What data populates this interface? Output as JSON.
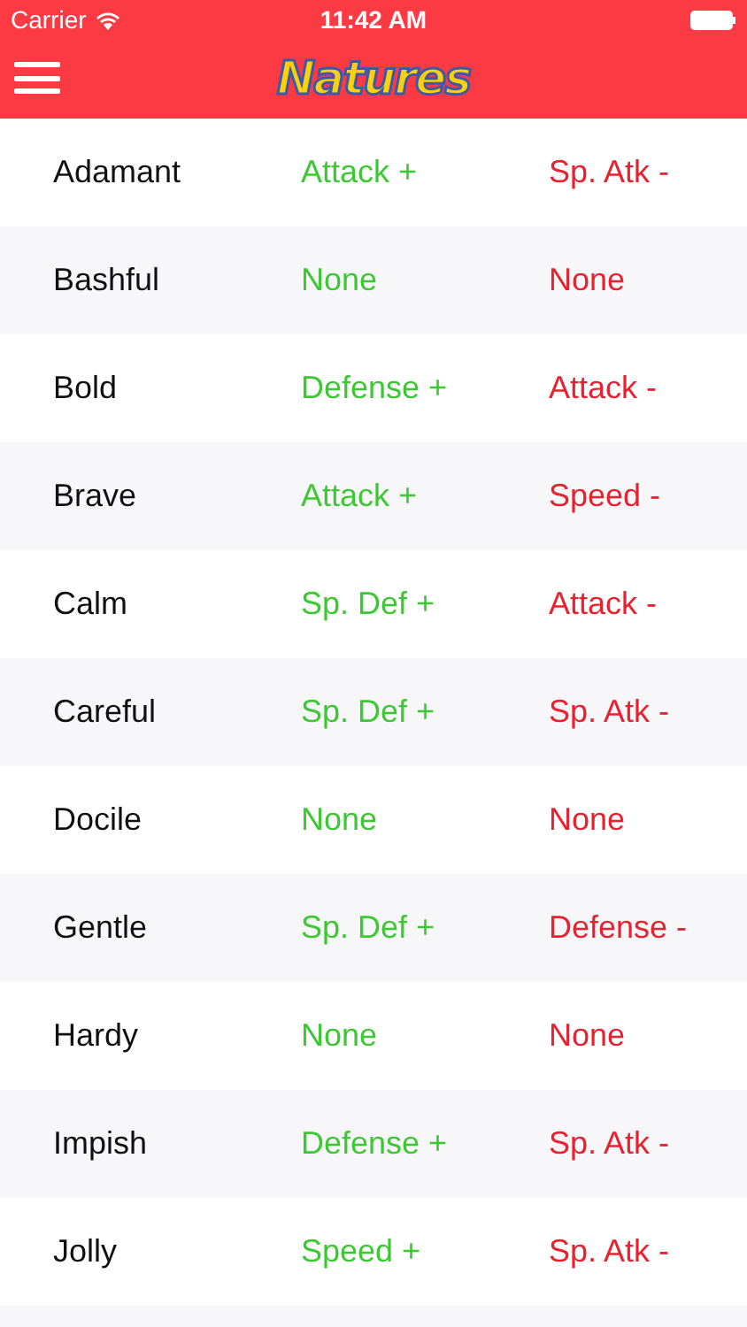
{
  "status_bar": {
    "carrier": "Carrier",
    "time": "11:42 AM"
  },
  "nav_bar": {
    "title": "Natures"
  },
  "natures": [
    {
      "name": "Adamant",
      "increased": "Attack +",
      "decreased": "Sp. Atk -"
    },
    {
      "name": "Bashful",
      "increased": "None",
      "decreased": "None"
    },
    {
      "name": "Bold",
      "increased": "Defense +",
      "decreased": "Attack -"
    },
    {
      "name": "Brave",
      "increased": "Attack +",
      "decreased": "Speed -"
    },
    {
      "name": "Calm",
      "increased": "Sp. Def +",
      "decreased": "Attack -"
    },
    {
      "name": "Careful",
      "increased": "Sp. Def +",
      "decreased": "Sp. Atk -"
    },
    {
      "name": "Docile",
      "increased": "None",
      "decreased": "None"
    },
    {
      "name": "Gentle",
      "increased": "Sp. Def +",
      "decreased": "Defense -"
    },
    {
      "name": "Hardy",
      "increased": "None",
      "decreased": "None"
    },
    {
      "name": "Impish",
      "increased": "Defense +",
      "decreased": "Sp. Atk -"
    },
    {
      "name": "Jolly",
      "increased": "Speed +",
      "decreased": "Sp. Atk -"
    }
  ]
}
